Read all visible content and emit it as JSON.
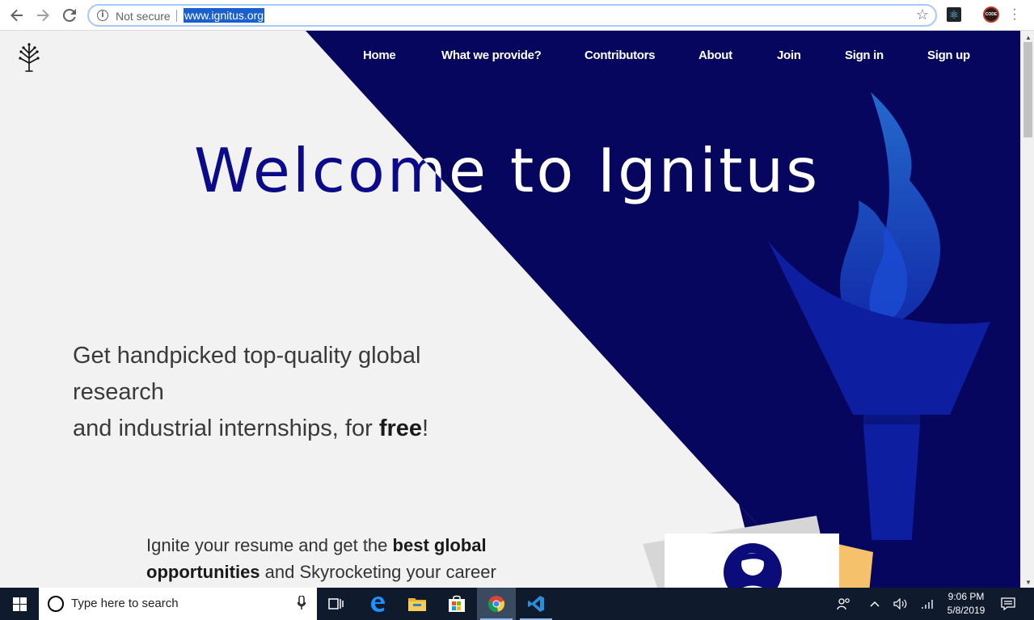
{
  "browser": {
    "security_label": "Not secure",
    "url": "www.ignitus.org",
    "info_icon": "info-icon",
    "extensions": [
      {
        "name": "react-devtools-icon"
      },
      {
        "name": "code-profile-icon",
        "label": "CODE"
      }
    ]
  },
  "site": {
    "nav": {
      "home": "Home",
      "provide": "What we provide?",
      "contributors": "Contributors",
      "about": "About",
      "join": "Join",
      "signin": "Sign in",
      "signup": "Sign up"
    },
    "hero": {
      "title": "Welcome to Ignitus",
      "tagline_line1": "Get handpicked top-quality global",
      "tagline_line2": "research",
      "tagline_line3_pre": "and industrial internships, for ",
      "tagline_line3_bold": "free",
      "tagline_line3_post": "!",
      "sub_line1_pre": "Ignite your resume and get the ",
      "sub_line1_bold": "best global",
      "sub_line2_bold": "opportunities",
      "sub_line2_post": " and Skyrocketing your career"
    },
    "colors": {
      "brand_dark": "#06065f",
      "brand_title": "#0b0b8a",
      "torch_blue": "#0d1fa0",
      "card_yellow": "#f5c26b"
    }
  },
  "taskbar": {
    "search_placeholder": "Type here to search",
    "time": "9:06 PM",
    "date": "5/8/2019"
  }
}
